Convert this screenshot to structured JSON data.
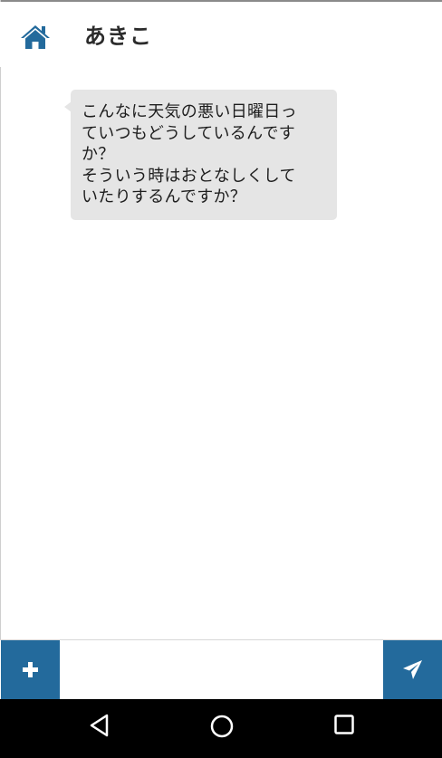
{
  "header": {
    "title": "あきこ",
    "home_icon": "home-icon"
  },
  "messages": [
    {
      "sender": "other",
      "text": "こんなに天気の悪い日曜日っ\nていつもどうしているんです\nか？\nそういう時はおとなしくして\nいたりするんですか？"
    }
  ],
  "composer": {
    "add_icon": "plus-icon",
    "input_value": "",
    "input_placeholder": "",
    "send_icon": "paper-plane-icon"
  },
  "navbar": {
    "back_icon": "back-triangle-icon",
    "home_icon": "home-circle-icon",
    "recent_icon": "recent-apps-square-icon"
  },
  "colors": {
    "accent": "#236a9c",
    "bubble": "#e5e5e5",
    "navbar": "#000000"
  }
}
